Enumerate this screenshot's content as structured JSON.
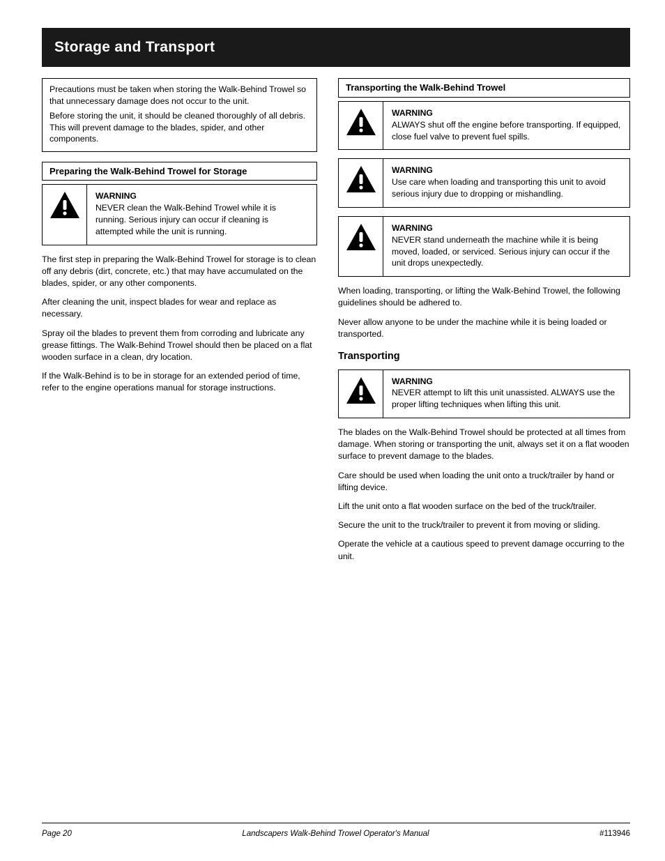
{
  "title": "Storage and Transport",
  "intro": {
    "p1": "Precautions must be taken when storing the Walk-Behind Trowel so that unnecessary damage does not occur to the unit.",
    "p2": "Before storing the unit, it should be cleaned thoroughly of all debris. This will prevent damage to the blades, spider, and other components."
  },
  "left": {
    "sectionLabel": "Preparing the Walk-Behind Trowel for Storage",
    "warn1Label": "WARNING",
    "warn1Text": "NEVER clean the Walk-Behind Trowel while it is running. Serious injury can occur if cleaning is attempted while the unit is running.",
    "p1": "The first step in preparing the Walk-Behind Trowel for storage is to clean off any debris (dirt, concrete, etc.) that may have accumulated on the blades, spider, or any other components.",
    "p2": "After cleaning the unit, inspect blades for wear and replace as necessary.",
    "p3": "Spray oil the blades to prevent them from corroding and lubricate any grease fittings. The Walk-Behind Trowel should then be placed on a flat wooden surface in a clean, dry location.",
    "p4": "If the Walk-Behind is to be in storage for an extended period of time, refer to the engine operations manual for storage instructions."
  },
  "right": {
    "sectionLabel": "Transporting the Walk-Behind Trowel",
    "warn1Label": "WARNING",
    "warn1Text": "ALWAYS shut off the engine before transporting. If equipped, close fuel valve to prevent fuel spills.",
    "warn2Label": "WARNING",
    "warn2Text": "Use care when loading and transporting this unit to avoid serious injury due to dropping or mishandling.",
    "warn3Label": "WARNING",
    "warn3Text": "NEVER stand underneath the machine while it is being moved, loaded, or serviced. Serious injury can occur if the unit drops unexpectedly.",
    "p1": "When loading, transporting, or lifting the Walk-Behind Trowel, the following guidelines should be adhered to.",
    "p2": "Never allow anyone to be under the machine while it is being loaded or transported.",
    "transportHeading": "Transporting",
    "warn4Label": "WARNING",
    "warn4Text": "NEVER attempt to lift this unit unassisted. ALWAYS use the proper lifting techniques when lifting this unit.",
    "tp1": "The blades on the Walk-Behind Trowel should be protected at all times from damage. When storing or transporting the unit, always set it on a flat wooden surface to prevent damage to the blades.",
    "tp2": "Care should be used when loading the unit onto a truck/trailer by hand or lifting device.",
    "tp3": "Lift the unit onto a flat wooden surface on the bed of the truck/trailer.",
    "tp4": "Secure the unit to the truck/trailer to prevent it from moving or sliding.",
    "tp5": "Operate the vehicle at a cautious speed to prevent damage occurring to the unit."
  },
  "footer": {
    "pageLabel": "Page 20",
    "docTitle": "Landscapers Walk-Behind Trowel Operator's Manual",
    "ref": "#113946"
  }
}
